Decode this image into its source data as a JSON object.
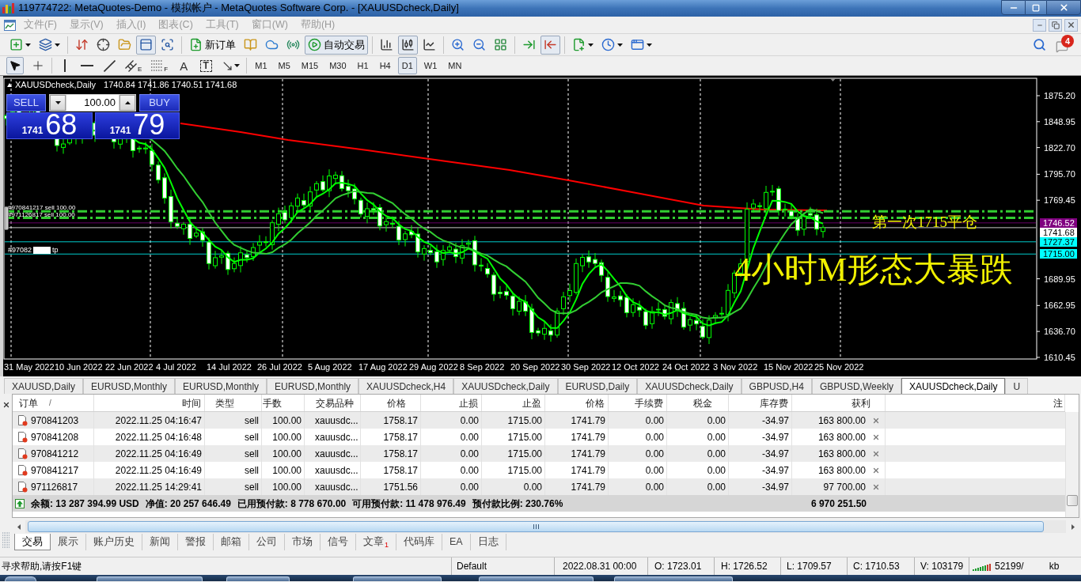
{
  "window": {
    "title": "119774722: MetaQuotes-Demo - 模拟帐户 - MetaQuotes Software Corp. - [XAUUSDcheck,Daily]"
  },
  "menu": [
    {
      "label": "文件(F)",
      "disabled": true
    },
    {
      "label": "显示(V)",
      "disabled": true
    },
    {
      "label": "插入(I)",
      "disabled": true
    },
    {
      "label": "图表(C)",
      "disabled": true
    },
    {
      "label": "工具(T)",
      "disabled": true
    },
    {
      "label": "窗口(W)",
      "disabled": true
    },
    {
      "label": "帮助(H)",
      "disabled": true
    }
  ],
  "toolbar": {
    "groups": [
      {
        "items": [
          {
            "kind": "new-chart",
            "pressed": false
          },
          {
            "kind": "profiles",
            "pressed": false
          }
        ]
      },
      {
        "items": [
          {
            "kind": "market-watch",
            "pressed": false
          },
          {
            "kind": "data-window",
            "pressed": false
          },
          {
            "kind": "navigator",
            "pressed": false
          },
          {
            "kind": "terminal",
            "pressed": true
          },
          {
            "kind": "tester",
            "pressed": false
          }
        ]
      },
      {
        "items": [
          {
            "kind": "new-order",
            "label": "新订单",
            "pressed": false
          },
          {
            "kind": "editor",
            "pressed": false
          },
          {
            "kind": "vps",
            "pressed": false
          },
          {
            "kind": "signals",
            "pressed": false
          },
          {
            "kind": "auto-trading",
            "label": "自动交易",
            "pressed": true
          }
        ]
      },
      {
        "items": [
          {
            "kind": "bar-chart",
            "pressed": false
          },
          {
            "kind": "candle-chart",
            "pressed": true
          },
          {
            "kind": "line-chart",
            "pressed": false
          }
        ]
      },
      {
        "items": [
          {
            "kind": "zoom-in",
            "pressed": false
          },
          {
            "kind": "zoom-out",
            "pressed": false
          },
          {
            "kind": "tile",
            "pressed": false
          }
        ]
      },
      {
        "items": [
          {
            "kind": "autoscroll",
            "pressed": false
          },
          {
            "kind": "chart-shift",
            "pressed": true
          }
        ]
      },
      {
        "items": [
          {
            "kind": "indicators",
            "pressed": false
          },
          {
            "kind": "periods",
            "pressed": false
          },
          {
            "kind": "templates",
            "pressed": false
          }
        ]
      }
    ],
    "notification_badge": "4"
  },
  "drawing_tools": [
    {
      "tools": [
        {
          "kind": "cursor",
          "selected": true
        },
        {
          "kind": "crosshair",
          "selected": false
        }
      ]
    },
    {
      "tools": [
        {
          "kind": "vertical-line",
          "selected": false
        },
        {
          "kind": "horizontal-line",
          "selected": false
        },
        {
          "kind": "trend-line",
          "selected": false
        },
        {
          "kind": "channel",
          "glyph": "E",
          "selected": false
        },
        {
          "kind": "fibonacci",
          "glyph": "F",
          "selected": false
        },
        {
          "kind": "text",
          "glyph": "A",
          "selected": false
        },
        {
          "kind": "text-label",
          "glyph": "T",
          "selected": false
        },
        {
          "kind": "arrows",
          "selected": false
        }
      ]
    }
  ],
  "timeframes": [
    {
      "label": "M1",
      "selected": false
    },
    {
      "label": "M5",
      "selected": false
    },
    {
      "label": "M15",
      "selected": false
    },
    {
      "label": "M30",
      "selected": false
    },
    {
      "label": "H1",
      "selected": false
    },
    {
      "label": "H4",
      "selected": false
    },
    {
      "label": "D1",
      "selected": true
    },
    {
      "label": "W1",
      "selected": false
    },
    {
      "label": "MN",
      "selected": false
    }
  ],
  "chart": {
    "symbol": "XAUUSDcheck,Daily",
    "ohlc": "1740.84 1741.86 1740.51 1741.68",
    "trade_panel": {
      "sell": "SELL",
      "buy": "BUY",
      "volume": "100.00",
      "sell_price": {
        "head": "1741",
        "tail": "68"
      },
      "buy_price": {
        "head": "1741",
        "tail": "79"
      }
    },
    "order_labels": [
      "#970841217 sell 100.00",
      "#971126817 sell 100.00"
    ],
    "tp_label": {
      "prefix": "#97082",
      "suffix": "tp"
    },
    "annotations": [
      {
        "kind": "small",
        "text": "第一次1715平仓"
      },
      {
        "kind": "large",
        "text": "4小时M形态大暴跌"
      }
    ],
    "price_ticks": [
      "1875.20",
      "1848.95",
      "1822.70",
      "1795.70",
      "1769.45",
      "1689.95",
      "1662.95",
      "1636.70",
      "1610.45"
    ],
    "price_markers": [
      {
        "label": "1746.52",
        "color": "#800080"
      },
      {
        "label": "1741.68",
        "color": "#ffffff"
      },
      {
        "label": "1727.37",
        "color": "#00ffff"
      },
      {
        "label": "1715.00",
        "color": "#00ffff"
      }
    ],
    "date_labels": [
      "31 May 2022",
      "10 Jun 2022",
      "22 Jun 2022",
      "4 Jul 2022",
      "14 Jul 2022",
      "26 Jul 2022",
      "5 Aug 2022",
      "17 Aug 2022",
      "29 Aug 2022",
      "8 Sep 2022",
      "20 Sep 2022",
      "30 Sep 2022",
      "12 Oct 2022",
      "24 Oct 2022",
      "3 Nov 2022",
      "15 Nov 2022",
      "25 Nov 2022"
    ]
  },
  "chart_tabs": [
    {
      "label": "XAUUSD,Daily",
      "selected": false
    },
    {
      "label": "EURUSD,Monthly",
      "selected": false
    },
    {
      "label": "EURUSD,Monthly",
      "selected": false
    },
    {
      "label": "EURUSD,Monthly",
      "selected": false
    },
    {
      "label": "XAUUSDcheck,H4",
      "selected": false
    },
    {
      "label": "XAUUSDcheck,Daily",
      "selected": false
    },
    {
      "label": "EURUSD,Daily",
      "selected": false
    },
    {
      "label": "XAUUSDcheck,Daily",
      "selected": false
    },
    {
      "label": "GBPUSD,H4",
      "selected": false
    },
    {
      "label": "GBPUSD,Weekly",
      "selected": false
    },
    {
      "label": "XAUUSDcheck,Daily",
      "selected": true
    },
    {
      "label": "U",
      "selected": false
    }
  ],
  "trade_table": {
    "columns": [
      "订单",
      "时间",
      "类型",
      "手数",
      "交易品种",
      "价格",
      "止损",
      "止盈",
      "价格",
      "手续费",
      "税金",
      "库存费",
      "获利",
      "注"
    ],
    "sort_mark": "/",
    "rows": [
      {
        "order": "970841203",
        "time": "2022.11.25 04:16:47",
        "type": "sell",
        "volume": "100.00",
        "symbol": "xauusdc...",
        "open_price": "1758.17",
        "stop_loss": "0.00",
        "take_profit": "1715.00",
        "price": "1741.79",
        "commission": "0.00",
        "taxes": "0.00",
        "swap": "-34.97",
        "profit": "163 800.00"
      },
      {
        "order": "970841208",
        "time": "2022.11.25 04:16:48",
        "type": "sell",
        "volume": "100.00",
        "symbol": "xauusdc...",
        "open_price": "1758.17",
        "stop_loss": "0.00",
        "take_profit": "1715.00",
        "price": "1741.79",
        "commission": "0.00",
        "taxes": "0.00",
        "swap": "-34.97",
        "profit": "163 800.00"
      },
      {
        "order": "970841212",
        "time": "2022.11.25 04:16:49",
        "type": "sell",
        "volume": "100.00",
        "symbol": "xauusdc...",
        "open_price": "1758.17",
        "stop_loss": "0.00",
        "take_profit": "1715.00",
        "price": "1741.79",
        "commission": "0.00",
        "taxes": "0.00",
        "swap": "-34.97",
        "profit": "163 800.00"
      },
      {
        "order": "970841217",
        "time": "2022.11.25 04:16:49",
        "type": "sell",
        "volume": "100.00",
        "symbol": "xauusdc...",
        "open_price": "1758.17",
        "stop_loss": "0.00",
        "take_profit": "1715.00",
        "price": "1741.79",
        "commission": "0.00",
        "taxes": "0.00",
        "swap": "-34.97",
        "profit": "163 800.00"
      },
      {
        "order": "971126817",
        "time": "2022.11.25 14:29:41",
        "type": "sell",
        "volume": "100.00",
        "symbol": "xauusdc...",
        "open_price": "1751.56",
        "stop_loss": "0.00",
        "take_profit": "0.00",
        "price": "1741.79",
        "commission": "0.00",
        "taxes": "0.00",
        "swap": "-34.97",
        "profit": "97 700.00"
      }
    ],
    "summary": {
      "items": [
        "余额: 13 287 394.99 USD",
        "净值: 20 257 646.49",
        "已用预付款: 8 778 670.00",
        "可用预付款: 11 478 976.49",
        "预付款比例: 230.76%"
      ],
      "total": "6 970 251.50"
    }
  },
  "bottom_tabs": [
    {
      "label": "交易",
      "selected": true
    },
    {
      "label": "展示",
      "selected": false
    },
    {
      "label": "账户历史",
      "selected": false
    },
    {
      "label": "新闻",
      "selected": false
    },
    {
      "label": "警报",
      "selected": false
    },
    {
      "label": "邮箱",
      "selected": false
    },
    {
      "label": "公司",
      "selected": false
    },
    {
      "label": "市场",
      "selected": false
    },
    {
      "label": "信号",
      "selected": false
    },
    {
      "label": "文章",
      "badge": "1",
      "selected": false
    },
    {
      "label": "代码库",
      "selected": false
    },
    {
      "label": "EA",
      "selected": false
    },
    {
      "label": "日志",
      "selected": false
    }
  ],
  "status_bar": {
    "help": "寻求帮助,请按F1键",
    "profile": "Default",
    "datetime": "2022.08.31 00:00",
    "open": "O: 1723.01",
    "high": "H: 1726.52",
    "low": "L: 1709.57",
    "close": "C: 1710.53",
    "volume": "V: 103179",
    "traffic": "52199/",
    "traffic_unit": "kb"
  }
}
